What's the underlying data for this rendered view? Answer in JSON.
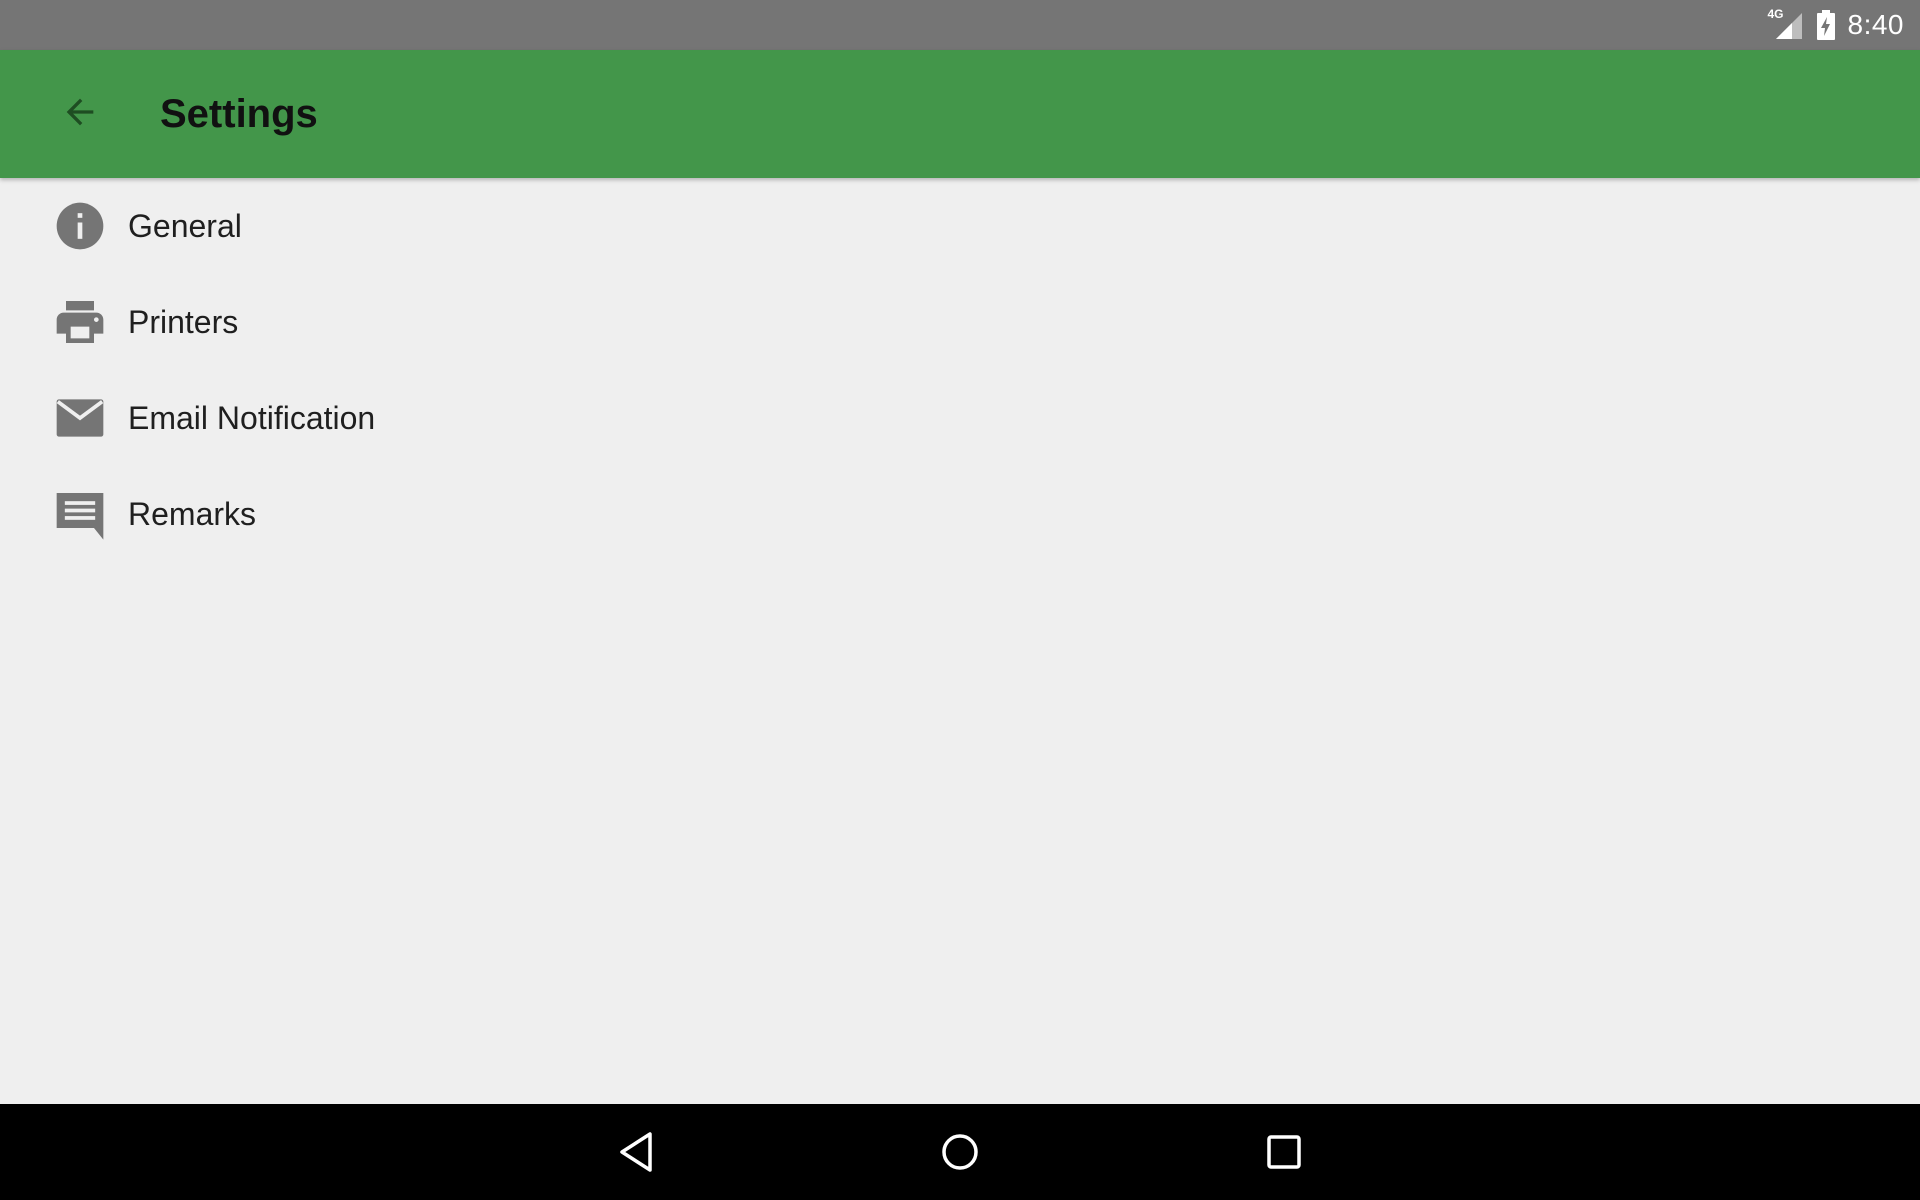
{
  "status_bar": {
    "network_label": "4G",
    "time": "8:40",
    "icons": [
      "signal-icon",
      "battery-charging-icon"
    ]
  },
  "app_bar": {
    "title": "Settings",
    "back_icon": "arrow-back-icon",
    "color": "#43964a"
  },
  "settings": {
    "items": [
      {
        "label": "General",
        "icon": "info-icon"
      },
      {
        "label": "Printers",
        "icon": "printer-icon"
      },
      {
        "label": "Email Notification",
        "icon": "mail-icon"
      },
      {
        "label": "Remarks",
        "icon": "comment-icon"
      }
    ]
  },
  "nav_bar": {
    "buttons": [
      "back-triangle-icon",
      "home-circle-icon",
      "recents-square-icon"
    ]
  },
  "colors": {
    "status_bar": "#757575",
    "background": "#efefef",
    "icon_gray": "#757575",
    "nav_bar": "#000000"
  }
}
